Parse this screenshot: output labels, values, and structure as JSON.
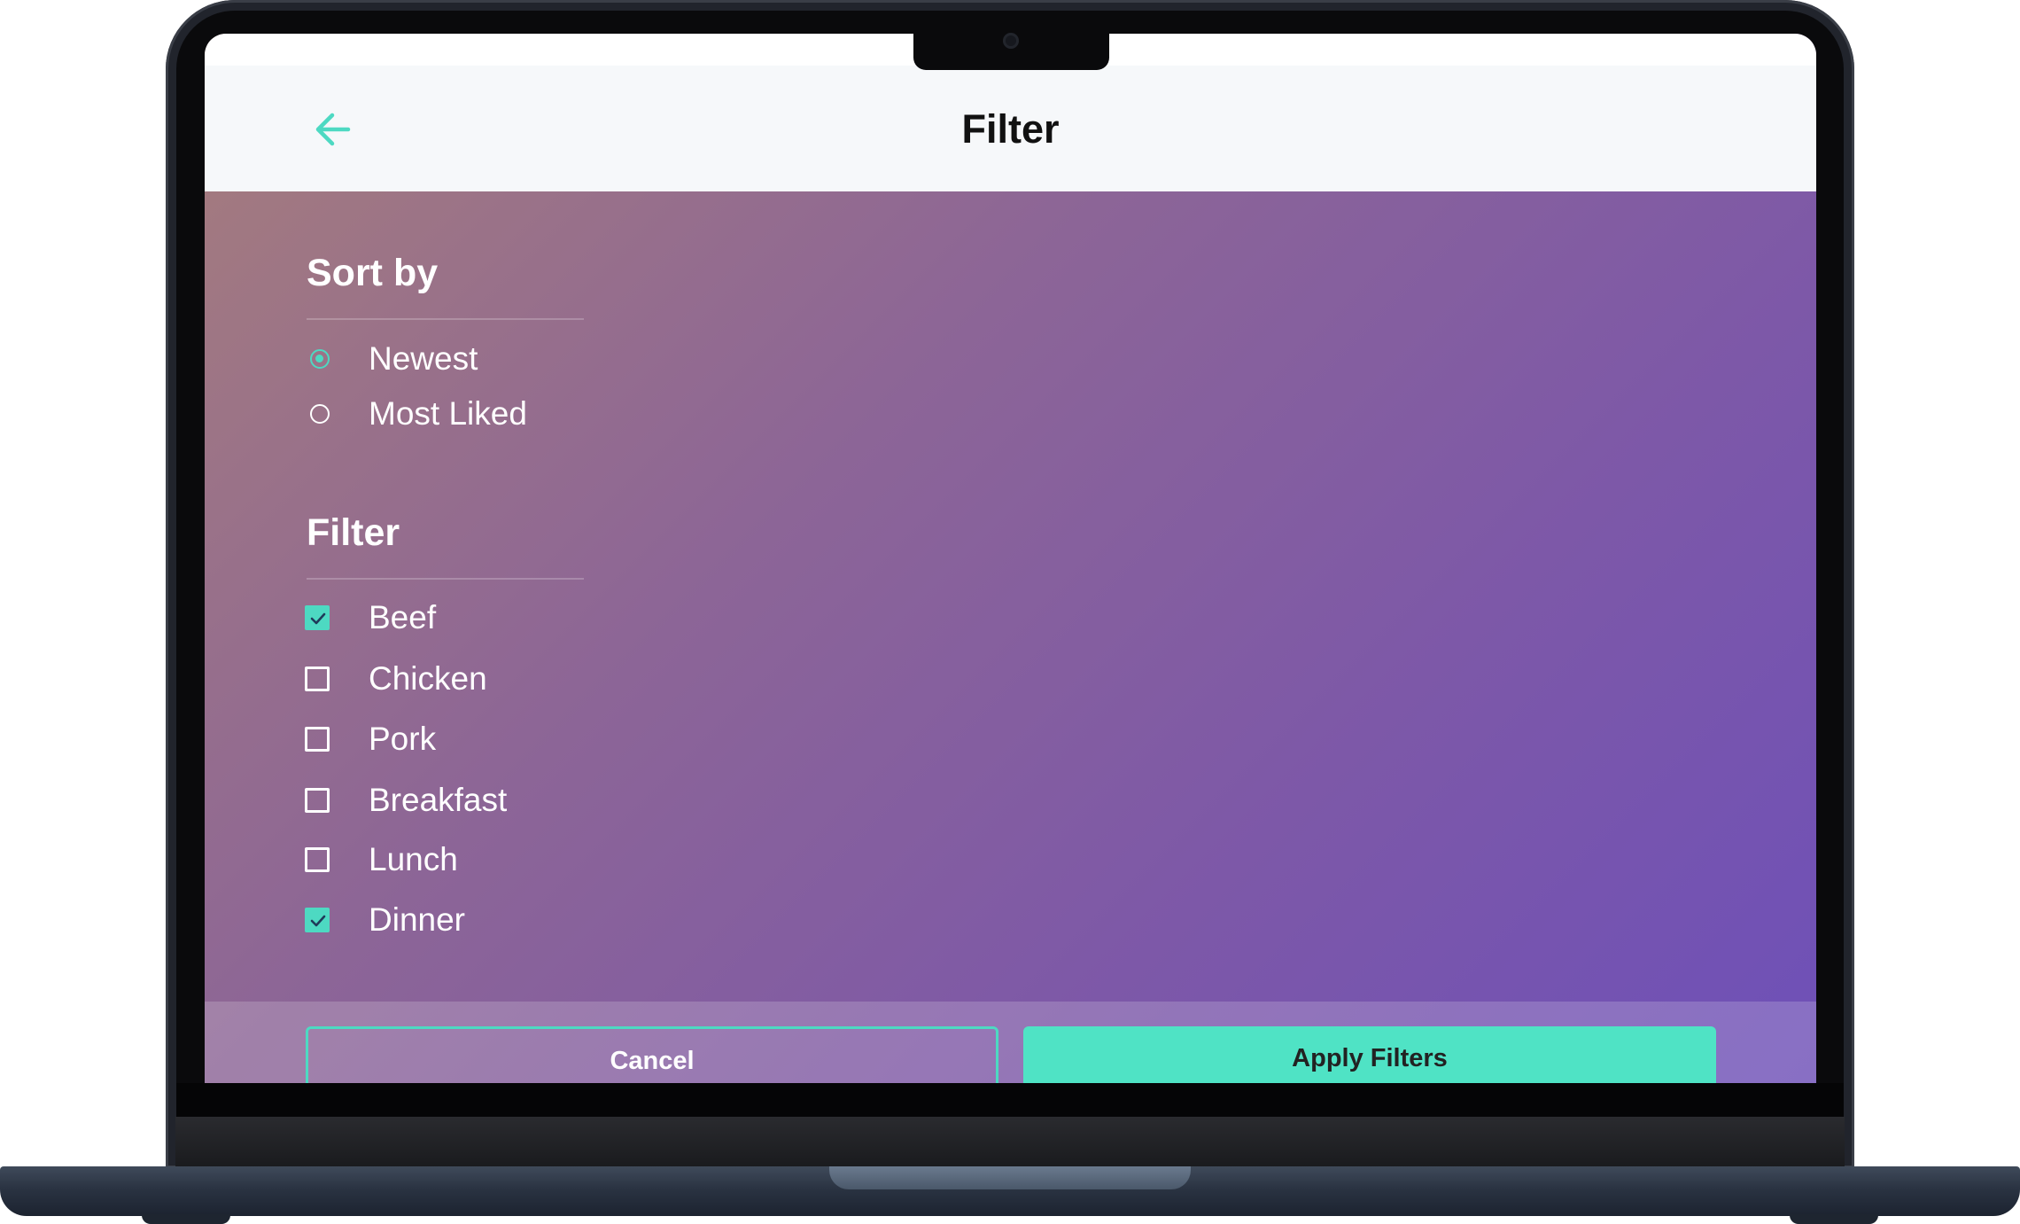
{
  "header": {
    "title": "Filter"
  },
  "sort": {
    "title": "Sort by",
    "options": [
      {
        "label": "Newest",
        "selected": true
      },
      {
        "label": "Most Liked",
        "selected": false
      }
    ]
  },
  "filter": {
    "title": "Filter",
    "options": [
      {
        "label": "Beef",
        "checked": true
      },
      {
        "label": "Chicken",
        "checked": false
      },
      {
        "label": "Pork",
        "checked": false
      },
      {
        "label": "Breakfast",
        "checked": false
      },
      {
        "label": "Lunch",
        "checked": false
      },
      {
        "label": "Dinner",
        "checked": true
      }
    ]
  },
  "footer": {
    "cancel_label": "Cancel",
    "apply_label": "Apply Filters"
  },
  "colors": {
    "accent": "#4dd9c2",
    "header_bg": "#f6f8fa",
    "laptop_frame": "#21242c"
  },
  "icons": {
    "back": "arrow-left-icon",
    "checked": "checkmark-icon"
  }
}
